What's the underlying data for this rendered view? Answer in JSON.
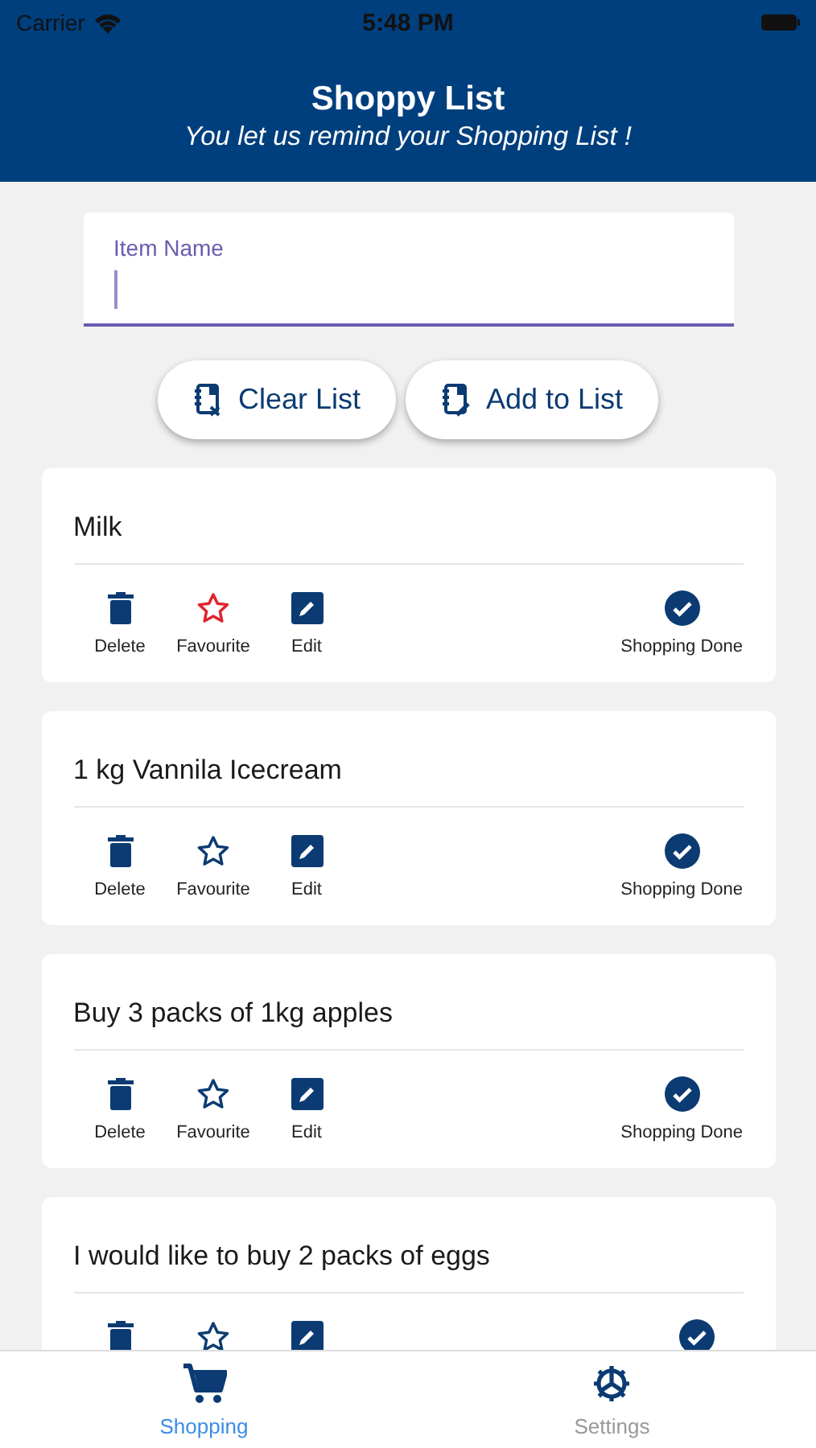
{
  "status_bar": {
    "carrier": "Carrier",
    "time": "5:48 PM"
  },
  "header": {
    "title": "Shoppy List",
    "subtitle": "You let us remind your Shopping List !"
  },
  "item_field": {
    "label": "Item Name"
  },
  "buttons": [
    {
      "kind": "clear",
      "label": "Clear List"
    },
    {
      "kind": "add",
      "label": "Add to List"
    }
  ],
  "items": [
    {
      "name": "Milk",
      "favourite": true,
      "labels": [
        "Delete",
        "Favourite",
        "Edit",
        "Shopping Done"
      ]
    },
    {
      "name": "1 kg Vannila Icecream",
      "favourite": false,
      "labels": [
        "Delete",
        "Favourite",
        "Edit",
        "Shopping Done"
      ]
    },
    {
      "name": "Buy 3 packs of 1kg apples",
      "favourite": false,
      "labels": [
        "Delete",
        "Favourite",
        "Edit",
        "Shopping Done"
      ]
    },
    {
      "name": "I would like to buy 2 packs of eggs",
      "favourite": false
    }
  ],
  "tabs": [
    {
      "kind": "cart",
      "label": "Shopping",
      "selected": true
    },
    {
      "kind": "gear",
      "label": "Settings",
      "selected": false
    }
  ]
}
